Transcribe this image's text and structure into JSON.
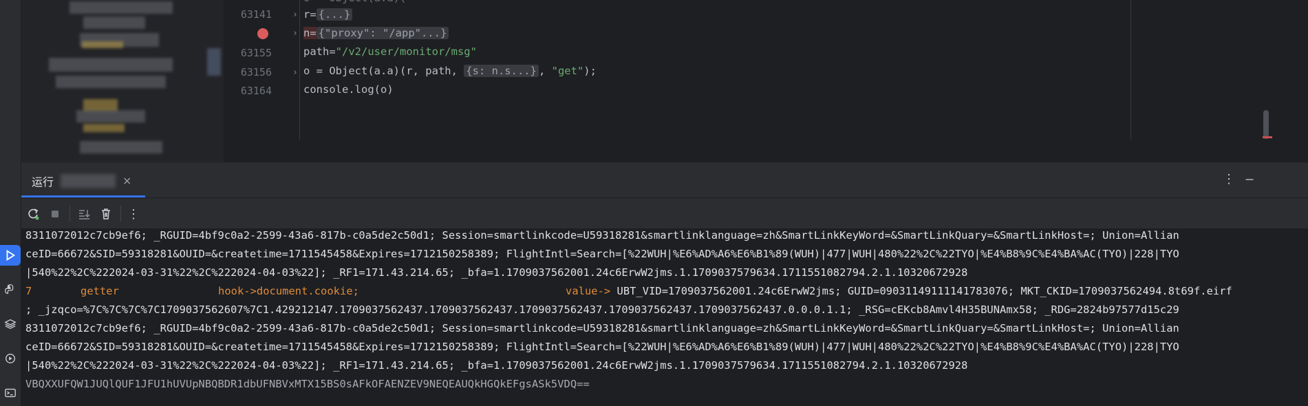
{
  "editor": {
    "lines": [
      {
        "no": "63141",
        "text_prefix": "r=",
        "inlay": "{...}"
      },
      {
        "no": "",
        "text_prefix": "n=",
        "inlay": "{\"proxy\": \"/app\"...}"
      },
      {
        "no": "63155",
        "code_a": "path=",
        "code_str": "\"/v2/user/monitor/msg\""
      },
      {
        "no": "63156",
        "code_a": "o = Object(a.a)(r, path, ",
        "inlay": "{s: n.s...}",
        "code_b": ", ",
        "code_str": "\"get\"",
        "code_c": ");"
      },
      {
        "no": "63164",
        "code_a": "console.log(o)"
      }
    ]
  },
  "run": {
    "tab_label": "运行",
    "close_glyph": "×",
    "more_glyph": "⋮",
    "minimize_glyph": "—"
  },
  "console": {
    "lines": [
      "8311072012c7cb9ef6; _RGUID=4bf9c0a2-2599-43a6-817b-c0a5de2c50d1; Session=smartlinkcode=U59318281&smartlinklanguage=zh&SmartLinkKeyWord=&SmartLinkQuary=&SmartLinkHost=; Union=Allian",
      "ceID=66672&SID=59318281&OUID=&createtime=1711545458&Expires=1712150258389; FlightIntl=Search=[%22WUH|%E6%AD%A6%E6%B1%89(WUH)|477|WUH|480%22%2C%22TYO|%E4%B8%9C%E4%BA%AC(TYO)|228|TYO",
      "|540%22%2C%222024-03-31%22%2C%222024-04-03%22]; _RF1=171.43.214.65; _bfa=1.1709037562001.24c6ErwW2jms.1.1709037579634.1711551082794.2.1.10320672928"
    ],
    "getter_line": {
      "num": "7",
      "kind": "getter",
      "hook": "hook->document.cookie;",
      "value_label": "value->",
      "value": " UBT_VID=1709037562001.24c6ErwW2jms; GUID=09031149111141783076; MKT_CKID=1709037562494.8t69f.eirf"
    },
    "lines2": [
      "; _jzqco=%7C%7C%7C%7C1709037562607%7C1.429212147.1709037562437.1709037562437.1709037562437.1709037562437.1709037562437.0.0.0.1.1; _RSG=cEKcb8Amvl4H35BUNAmx58; _RDG=2824b97577d15c29",
      "8311072012c7cb9ef6; _RGUID=4bf9c0a2-2599-43a6-817b-c0a5de2c50d1; Session=smartlinkcode=U59318281&smartlinklanguage=zh&SmartLinkKeyWord=&SmartLinkQuary=&SmartLinkHost=; Union=Allian",
      "ceID=66672&SID=59318281&OUID=&createtime=1711545458&Expires=1712150258389; FlightIntl=Search=[%22WUH|%E6%AD%A6%E6%B1%89(WUH)|477|WUH|480%22%2C%22TYO|%E4%B8%9C%E4%BA%AC(TYO)|228|TYO",
      "|540%22%2C%222024-03-31%22%2C%222024-04-03%22]; _RF1=171.43.214.65; _bfa=1.1709037562001.24c6ErwW2jms.1.1709037579634.1711551082794.2.1.10320672928"
    ],
    "last_line": "VBQXXUFQW1JUQlQUF1JFU1hUVUpNBQBDR1dbUFNBVxMTX15BS0sAFkOFAENZEV9NEQEAUQkHGQkEFgsASk5VDQ=="
  }
}
